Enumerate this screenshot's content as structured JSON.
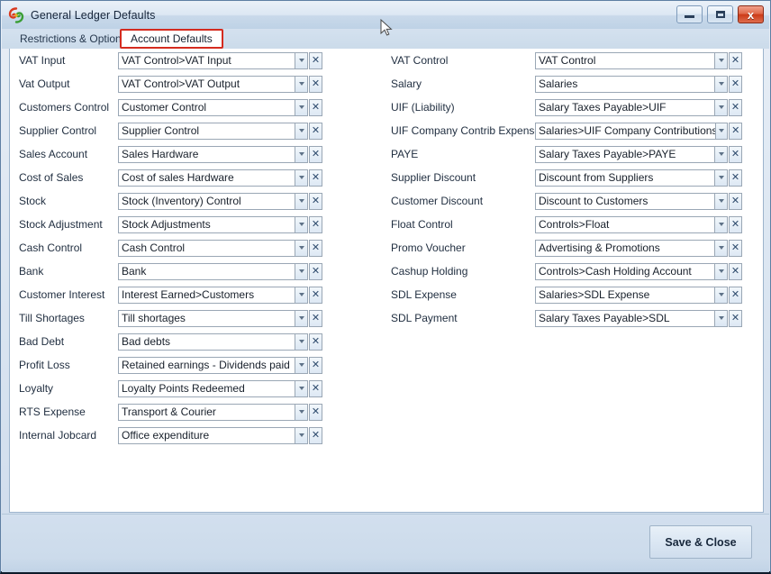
{
  "window": {
    "title": "General Ledger Defaults",
    "app_icon": "swirl-logo-icon",
    "controls": {
      "minimize_label": "Minimize",
      "maximize_label": "Maximize",
      "close_label": "x"
    }
  },
  "tabs": [
    {
      "label": "Restrictions & Options",
      "active": false
    },
    {
      "label": "Account Defaults",
      "active": true
    }
  ],
  "colors": {
    "active_tab_border": "#d42b1f",
    "titlebar_top": "#e9f0f8",
    "close_button": "#cc3b18",
    "panel_background": "#ffffff",
    "footer_background": "#ccdbeb"
  },
  "left_column": [
    {
      "label": "VAT Input",
      "value": "VAT Control>VAT Input"
    },
    {
      "label": "Vat Output",
      "value": "VAT Control>VAT Output"
    },
    {
      "label": "Customers Control",
      "value": "Customer Control"
    },
    {
      "label": "Supplier Control",
      "value": "Supplier Control"
    },
    {
      "label": "Sales Account",
      "value": "Sales Hardware"
    },
    {
      "label": "Cost of Sales",
      "value": "Cost of sales Hardware"
    },
    {
      "label": "Stock",
      "value": "Stock (Inventory) Control"
    },
    {
      "label": "Stock Adjustment",
      "value": "Stock Adjustments"
    },
    {
      "label": "Cash Control",
      "value": "Cash Control"
    },
    {
      "label": "Bank",
      "value": "Bank"
    },
    {
      "label": "Customer Interest",
      "value": "Interest Earned>Customers"
    },
    {
      "label": "Till Shortages",
      "value": "Till shortages"
    },
    {
      "label": "Bad Debt",
      "value": "Bad debts"
    },
    {
      "label": "Profit Loss",
      "value": "Retained earnings - Dividends paid"
    },
    {
      "label": "Loyalty",
      "value": "Loyalty Points Redeemed"
    },
    {
      "label": "RTS Expense",
      "value": "Transport & Courier"
    },
    {
      "label": "Internal Jobcard",
      "value": "Office expenditure"
    }
  ],
  "right_column": [
    {
      "label": "VAT Control",
      "value": "VAT Control"
    },
    {
      "label": "Salary",
      "value": "Salaries"
    },
    {
      "label": "UIF (Liability)",
      "value": "Salary Taxes Payable>UIF"
    },
    {
      "label": "UIF Company Contrib Expense",
      "value": "Salaries>UIF Company Contributions"
    },
    {
      "label": "PAYE",
      "value": "Salary Taxes Payable>PAYE"
    },
    {
      "label": "Supplier Discount",
      "value": "Discount  from Suppliers"
    },
    {
      "label": "Customer Discount",
      "value": "Discount to Customers"
    },
    {
      "label": "Float Control",
      "value": "Controls>Float"
    },
    {
      "label": "Promo Voucher",
      "value": "Advertising & Promotions"
    },
    {
      "label": "Cashup Holding",
      "value": "Controls>Cash Holding Account"
    },
    {
      "label": "SDL Expense",
      "value": "Salaries>SDL Expense"
    },
    {
      "label": "SDL Payment",
      "value": "Salary Taxes Payable>SDL"
    }
  ],
  "field_controls": {
    "dropdown_icon": "chevron-down-icon",
    "clear_icon": "close-x-icon",
    "clear_glyph": "✕"
  },
  "footer": {
    "save_label": "Save & Close"
  }
}
